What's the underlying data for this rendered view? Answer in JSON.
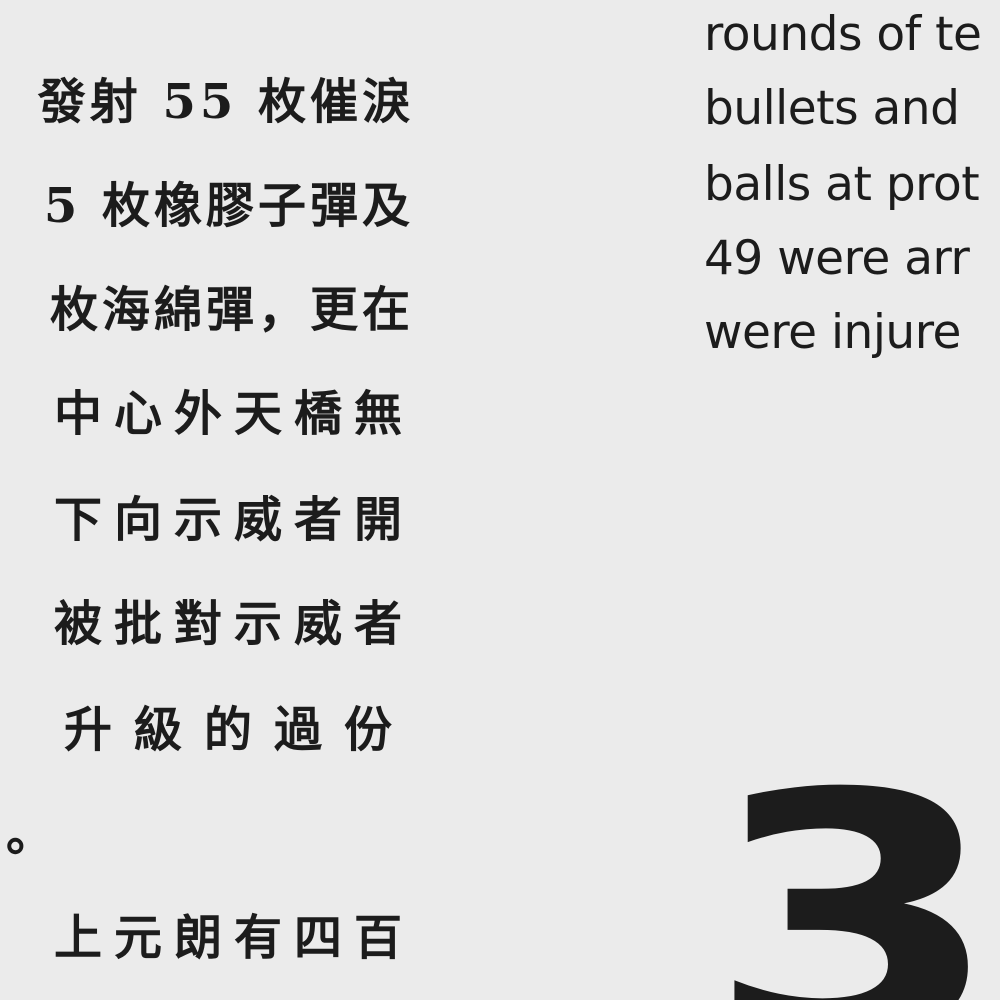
{
  "chinese_text": {
    "lines": [
      "發射 55 枚催淚",
      "5 枚橡膠子彈及",
      "枚海綿彈，更在",
      "中心外天橋無",
      "下向示威者開",
      "被批對示威者",
      "升級的過份",
      "。",
      "上元朗有四百"
    ]
  },
  "english_text": {
    "lines": [
      "rounds of te",
      "bullets and",
      "balls at prot",
      "49 were arr",
      "were injure"
    ]
  },
  "section_number": "3"
}
